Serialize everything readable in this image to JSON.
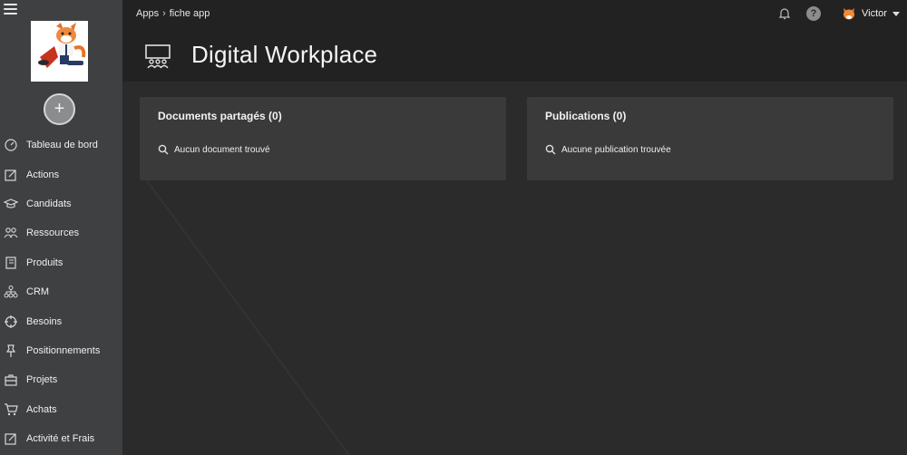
{
  "breadcrumb": {
    "root": "Apps",
    "current": "fiche app"
  },
  "user": {
    "name": "Victor"
  },
  "page": {
    "title": "Digital Workplace"
  },
  "sidebar": {
    "add_label": "+",
    "items": [
      {
        "label": "Tableau de bord",
        "icon": "dashboard-icon"
      },
      {
        "label": "Actions",
        "icon": "edit-icon"
      },
      {
        "label": "Candidats",
        "icon": "graduation-cap-icon"
      },
      {
        "label": "Ressources",
        "icon": "users-icon"
      },
      {
        "label": "Produits",
        "icon": "book-icon"
      },
      {
        "label": "CRM",
        "icon": "sitemap-icon"
      },
      {
        "label": "Besoins",
        "icon": "crosshair-icon"
      },
      {
        "label": "Positionnements",
        "icon": "pin-icon"
      },
      {
        "label": "Projets",
        "icon": "briefcase-icon"
      },
      {
        "label": "Achats",
        "icon": "cart-icon"
      },
      {
        "label": "Activité et Frais",
        "icon": "edit-icon"
      }
    ]
  },
  "panels": {
    "documents": {
      "title": "Documents partagés (0)",
      "empty": "Aucun document trouvé"
    },
    "publications": {
      "title": "Publications (0)",
      "empty": "Aucune publication trouvée"
    }
  },
  "colors": {
    "sidebar": "#3e4041",
    "topbar": "#222222",
    "content": "#2b2b2b",
    "panel": "#3a3a3a"
  }
}
